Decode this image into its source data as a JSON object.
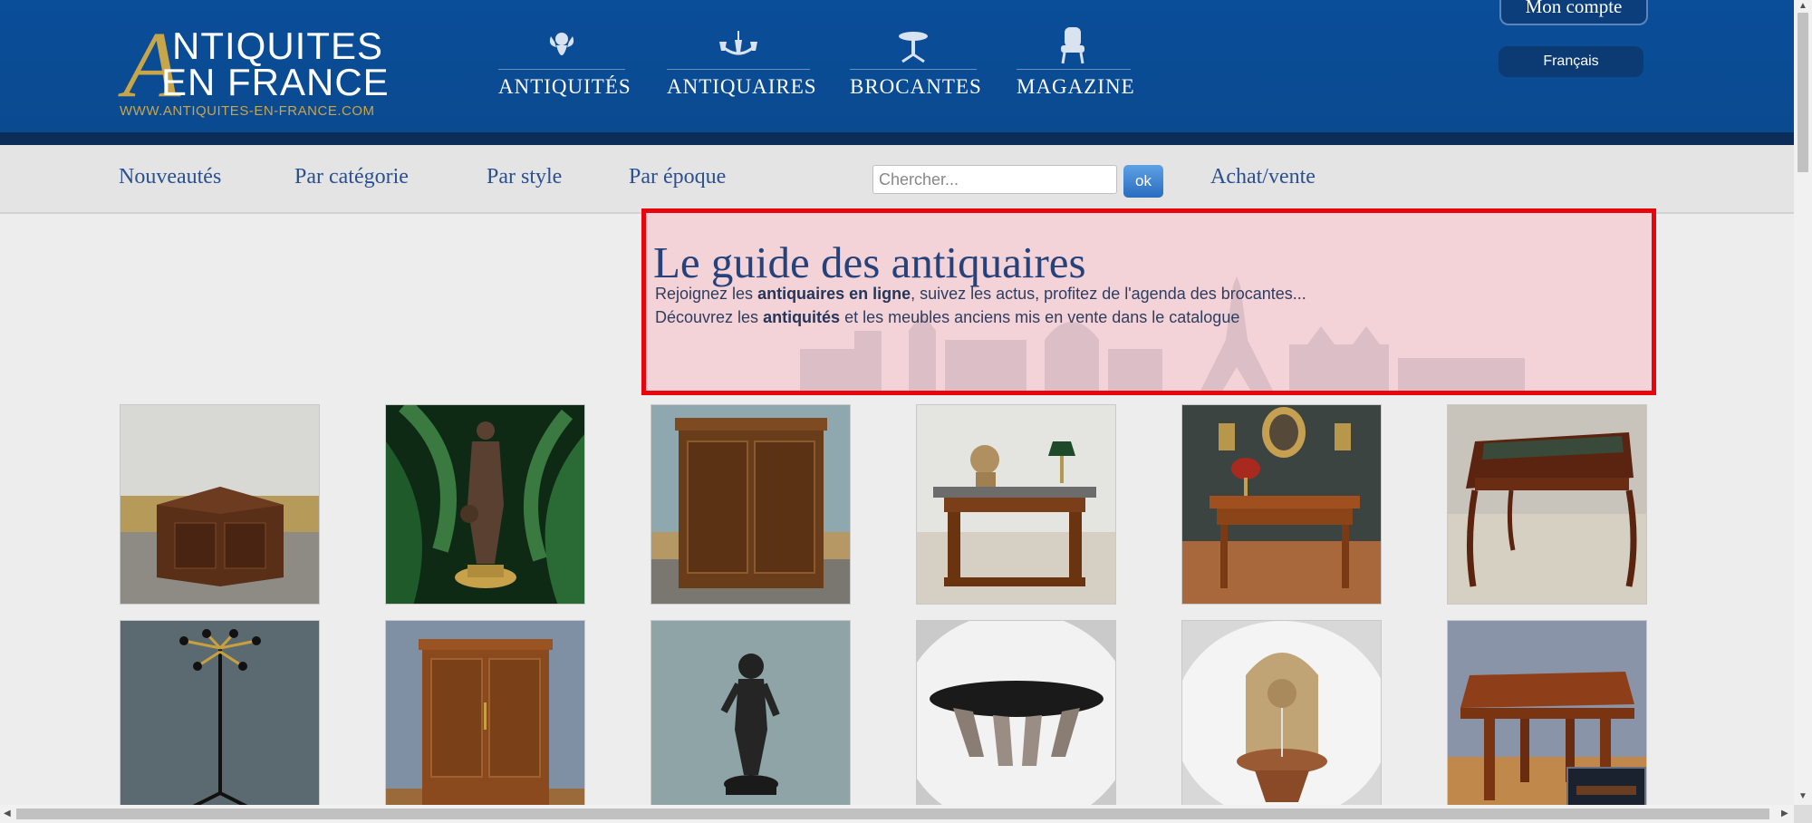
{
  "logo": {
    "initial": "A",
    "line1": "NTIQUITES",
    "line2": "EN FRANCE",
    "url": "WWW.ANTIQUITES-EN-FRANCE.COM"
  },
  "topnav": [
    {
      "label": "ANTIQUITÉS",
      "icon": "cherub-icon"
    },
    {
      "label": "ANTIQUAIRES",
      "icon": "chandelier-icon"
    },
    {
      "label": "BROCANTES",
      "icon": "gueridon-table-icon"
    },
    {
      "label": "MAGAZINE",
      "icon": "armchair-icon"
    }
  ],
  "account": {
    "label": "Mon compte"
  },
  "language": {
    "label": "Français"
  },
  "subnav": {
    "items": [
      "Nouveautés",
      "Par catégorie",
      "Par style",
      "Par époque"
    ],
    "search_placeholder": "Chercher...",
    "ok_label": "ok",
    "buy_sell": "Achat/vente"
  },
  "hero": {
    "title": "Le guide des antiquaires",
    "line1_pre": "Rejoignez les ",
    "line1_bold": "antiquaires en ligne",
    "line1_post": ", suivez les actus, profitez de l'agenda des brocantes...",
    "line2_pre": "Découvrez les ",
    "line2_bold": "antiquités",
    "line2_post": " et les meubles anciens mis en vente dans le catalogue"
  },
  "products": [
    {
      "name": "corner-cabinet"
    },
    {
      "name": "bronze-statue-girl"
    },
    {
      "name": "walnut-armoire"
    },
    {
      "name": "console-table-marble"
    },
    {
      "name": "mahogany-writing-table"
    },
    {
      "name": "bureau-plat-desk"
    },
    {
      "name": "coat-stand"
    },
    {
      "name": "cherrywood-cupboard"
    },
    {
      "name": "bronze-child-statue"
    },
    {
      "name": "glass-coffee-table"
    },
    {
      "name": "wall-fountain"
    },
    {
      "name": "extending-table"
    }
  ]
}
